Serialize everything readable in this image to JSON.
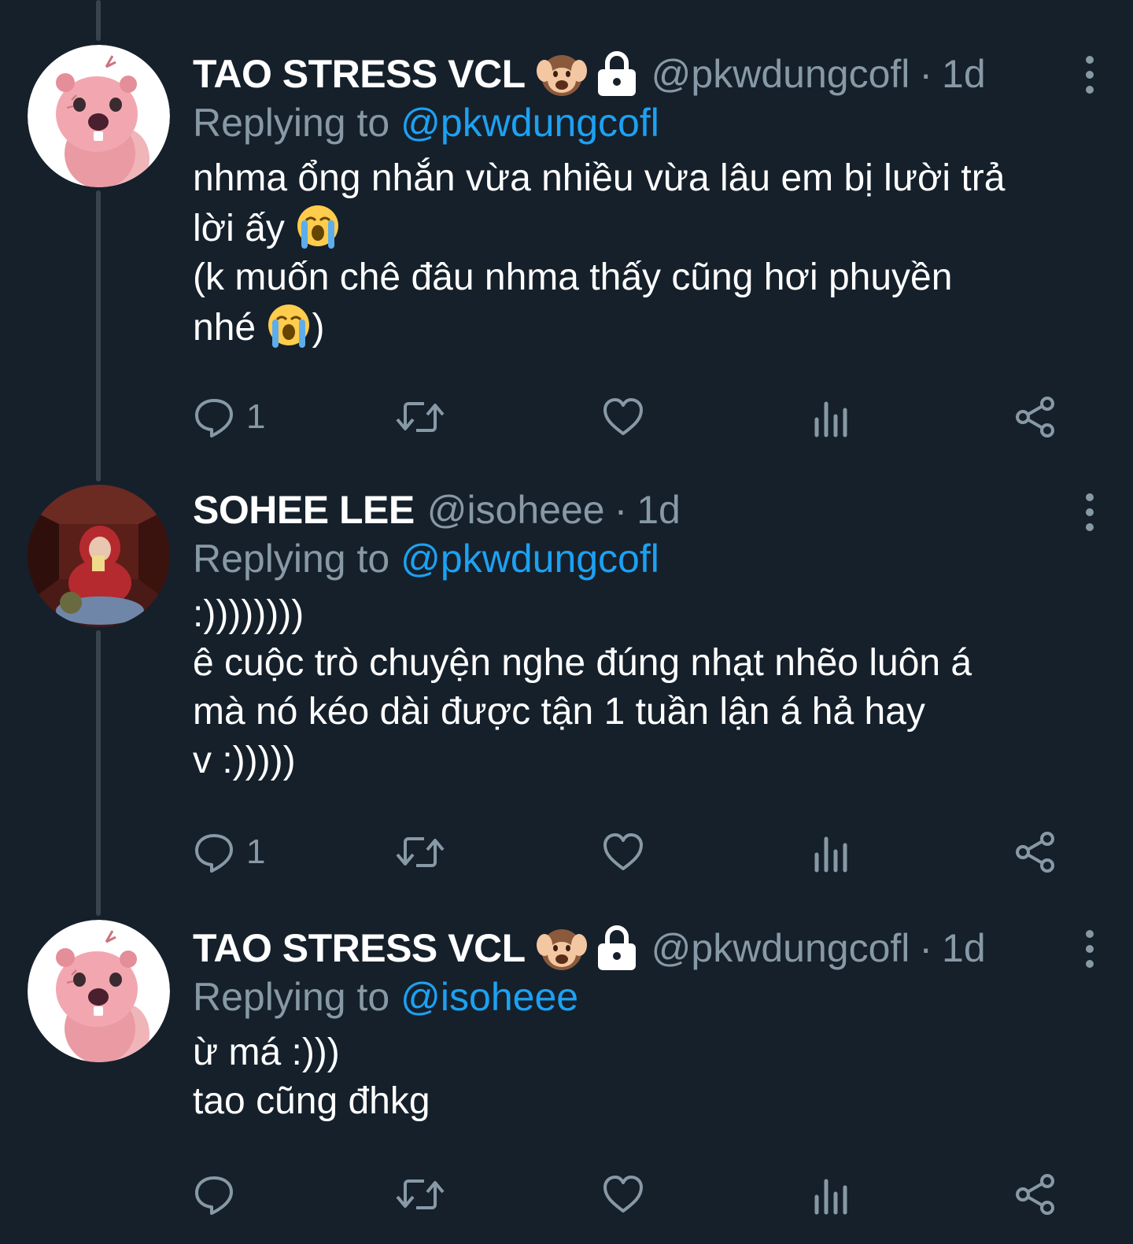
{
  "tweets": [
    {
      "display_name": "TAO STRESS VCL",
      "name_emoji": "hear-no-evil-monkey",
      "protected_icon": "lock-icon",
      "handle": "@pkwdungcofl",
      "separator": "·",
      "time": "1d",
      "reply_label": "Replying to",
      "reply_to": "@pkwdungcofl",
      "lines": [
        "nhma ổng nhắn vừa nhiều vừa lâu em bị lười trả",
        "lời ấy",
        "(k muốn chê đâu nhma thấy cũng hơi phuyền",
        "nhé",
        ")"
      ],
      "reply_count": "1"
    },
    {
      "display_name": "SOHEE LEE",
      "handle": "@isoheee",
      "separator": "·",
      "time": "1d",
      "reply_label": "Replying to",
      "reply_to": "@pkwdungcofl",
      "lines": [
        ":))))))))",
        "ê cuộc trò chuyện nghe đúng nhạt nhẽo luôn á",
        "mà nó kéo dài được tận 1 tuần lận á hả hay",
        "v :)))))"
      ],
      "reply_count": "1"
    },
    {
      "display_name": "TAO STRESS VCL",
      "name_emoji": "hear-no-evil-monkey",
      "protected_icon": "lock-icon",
      "handle": "@pkwdungcofl",
      "separator": "·",
      "time": "1d",
      "reply_label": "Replying to",
      "reply_to": "@isoheee",
      "lines": [
        "ừ má :)))",
        "tao cũng đhkg"
      ],
      "reply_count": ""
    }
  ],
  "icons": {
    "reply": "reply-icon",
    "retweet": "retweet-icon",
    "like": "heart-icon",
    "analytics": "analytics-icon",
    "share": "share-icon",
    "more": "more-vertical-icon",
    "crying": "loudly-crying-face-emoji"
  },
  "colors": {
    "background": "#15202b",
    "text_primary": "#ffffff",
    "text_secondary": "#8899a6",
    "accent_blue": "#1da1f2",
    "thread_line": "#38444d"
  }
}
